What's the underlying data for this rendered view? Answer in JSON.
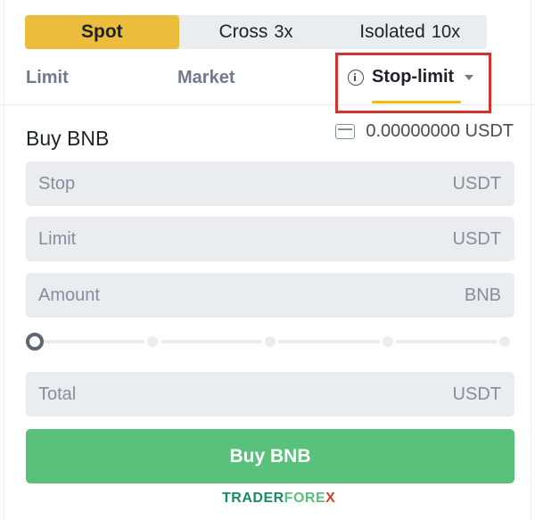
{
  "margin_modes": [
    {
      "label": "Spot",
      "multiplier": "",
      "active": true
    },
    {
      "label": "Cross",
      "multiplier": "3x",
      "active": false
    },
    {
      "label": "Isolated",
      "multiplier": "10x",
      "active": false
    }
  ],
  "order_tabs": {
    "limit": "Limit",
    "market": "Market",
    "stop_limit": "Stop-limit",
    "selected": "Stop-limit"
  },
  "form": {
    "title": "Buy BNB",
    "balance": "0.00000000 USDT",
    "stop": {
      "placeholder": "Stop",
      "unit": "USDT"
    },
    "limit": {
      "placeholder": "Limit",
      "unit": "USDT"
    },
    "amount": {
      "placeholder": "Amount",
      "unit": "BNB"
    },
    "total": {
      "placeholder": "Total",
      "unit": "USDT"
    },
    "slider_percent": 0,
    "submit_label": "Buy BNB"
  },
  "watermark": {
    "part1": "TRADER",
    "part2": "FORE",
    "part3": "X"
  },
  "colors": {
    "spot_active": "#ecbc3c",
    "buy": "#5ac17b",
    "highlight": "#d4322c",
    "underline": "#f0b90b"
  }
}
